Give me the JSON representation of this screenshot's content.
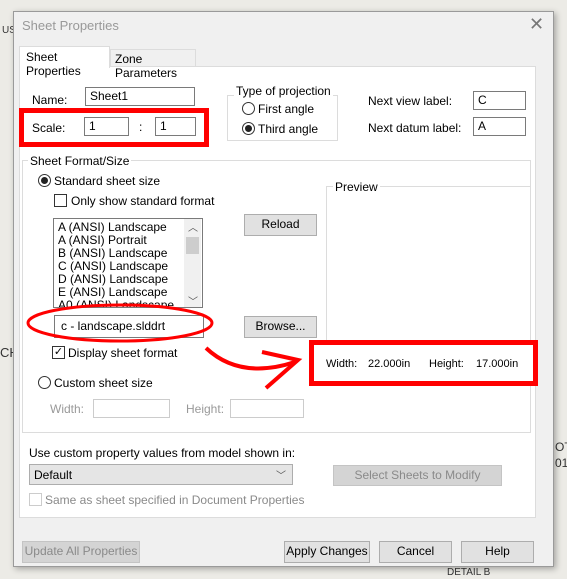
{
  "background": {
    "texts": [
      "US",
      "CH",
      "OT",
      "01",
      "DETAIL B"
    ]
  },
  "dialog": {
    "title": "Sheet Properties",
    "close_icon": "close-icon"
  },
  "tabs": [
    {
      "label": "Sheet Properties",
      "active": true
    },
    {
      "label": "Zone Parameters",
      "active": false
    }
  ],
  "name": {
    "label": "Name:",
    "value": "Sheet1"
  },
  "scale": {
    "label": "Scale:",
    "numerator": "1",
    "separator": ":",
    "denominator": "1"
  },
  "projection": {
    "legend": "Type of projection",
    "options": [
      {
        "label": "First angle",
        "selected": false
      },
      {
        "label": "Third angle",
        "selected": true
      }
    ]
  },
  "next_view": {
    "label": "Next view label:",
    "value": "C"
  },
  "next_datum": {
    "label": "Next datum label:",
    "value": "A"
  },
  "format": {
    "legend": "Sheet Format/Size",
    "standard": {
      "label": "Standard sheet size",
      "selected": true
    },
    "only_standard": {
      "label": "Only show standard format",
      "checked": false
    },
    "list": [
      "A (ANSI) Landscape",
      "A (ANSI) Portrait",
      "B (ANSI) Landscape",
      "C (ANSI) Landscape",
      "D (ANSI) Landscape",
      "E (ANSI) Landscape",
      "A0 (ANSI) Landscape"
    ],
    "reload": "Reload",
    "file": "c - landscape.slddrt",
    "browse": "Browse...",
    "display_format": {
      "label": "Display sheet format",
      "checked": true
    },
    "preview": "Preview",
    "width_label": "Width:",
    "width_value": "22.000in",
    "height_label": "Height:",
    "height_value": "17.000in",
    "custom": {
      "label": "Custom sheet size",
      "selected": false,
      "width_label": "Width:",
      "height_label": "Height:",
      "width": "",
      "height": ""
    }
  },
  "custom_prop": {
    "label": "Use custom property values from model shown in:",
    "value": "Default",
    "select_sheets": "Select Sheets to Modify",
    "same_as": {
      "label": "Same as sheet specified in Document Properties",
      "checked": false
    }
  },
  "buttons": {
    "update": "Update All Properties",
    "apply": "Apply Changes",
    "cancel": "Cancel",
    "help": "Help"
  },
  "colors": {
    "annotation": "#ff0000",
    "dialog_bg": "#f0f0f0"
  }
}
